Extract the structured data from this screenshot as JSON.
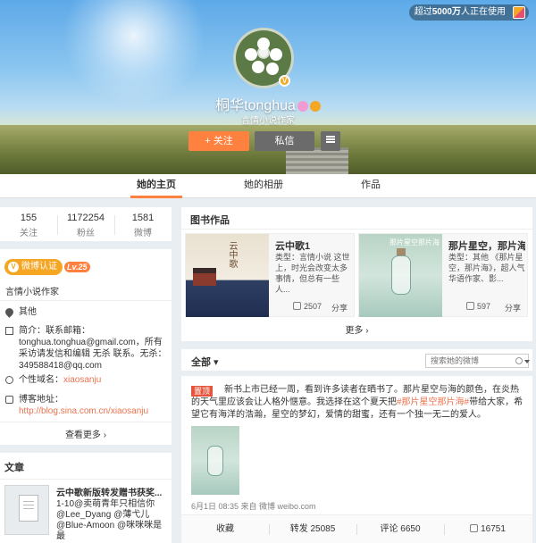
{
  "header": {
    "users_prefix": "超过",
    "users_count": "5000万",
    "users_suffix": "人正在使用",
    "nickname": "桐华tonghua",
    "subtitle": "言情小说作家",
    "follow_label": "+ 关注",
    "message_label": "私信"
  },
  "tabs": [
    {
      "label": "她的主页"
    },
    {
      "label": "她的相册"
    },
    {
      "label": "作品"
    }
  ],
  "stats": [
    {
      "num": "155",
      "label": "关注"
    },
    {
      "num": "1172254",
      "label": "粉丝"
    },
    {
      "num": "1581",
      "label": "微博"
    }
  ],
  "info": {
    "auth_label": "微博认证",
    "level": "Lv.25",
    "description": "言情小说作家",
    "location": "其他",
    "intro": "简介：联系邮箱：tonghua.tonghua@gmail.com，所有采访请发信和编辑 无杀 联系。无杀：349588418@qq.com",
    "domain_label": "个性域名：",
    "domain_value": "xiaosanju",
    "blog_label": "博客地址：",
    "blog_url": "http://blog.sina.com.cn/xiaosanju",
    "view_more": "查看更多 ›"
  },
  "articles": {
    "title": "文章",
    "item_title": "云中歌新版转发赠书获奖...",
    "item_desc": "1-10@卖萌青年只相信你 @Lee_Dyang @薄弋儿 @Blue-Amoon @咪咪咪是最"
  },
  "books": {
    "title": "图书作品",
    "items": [
      {
        "title": "云中歌1",
        "desc": "类型：言情小说 这世上，时光会改变太多事情，但总有一些人...",
        "likes": "2507",
        "share": "分享",
        "cover_text": "云中歌"
      },
      {
        "title": "那片星空，那片海...",
        "desc": "类型：其他 《那片星空，那片海》，超人气华语作家、影...",
        "likes": "597",
        "share": "分享",
        "cover_text": "那片星空那片海"
      }
    ],
    "more": "更多 ›"
  },
  "feed": {
    "filter_label": "全部 ▾",
    "search_placeholder": "搜索她的微博",
    "pin_label": "置顶",
    "post_text_1": "新书上市已经一周，看到许多读者在晒书了。那片星空与海的颜色，在炎热的天气里应该会让人格外惬意。我选择在这个夏天把",
    "post_link": "#那片星空那片海#",
    "post_text_2": "带给大家，希望它有海洋的浩瀚，星空的梦幻，爱情的甜蜜，还有一个独一无二的爱人。",
    "meta": "6月1日 08:35 来自 微博 weibo.com",
    "actions": {
      "collect": "收藏",
      "repost": "转发 25085",
      "comment": "评论 6650",
      "like": "16751"
    }
  },
  "colors": {
    "accent": "#ff8140",
    "link": "#eb7350",
    "auth": "#f5a623"
  }
}
